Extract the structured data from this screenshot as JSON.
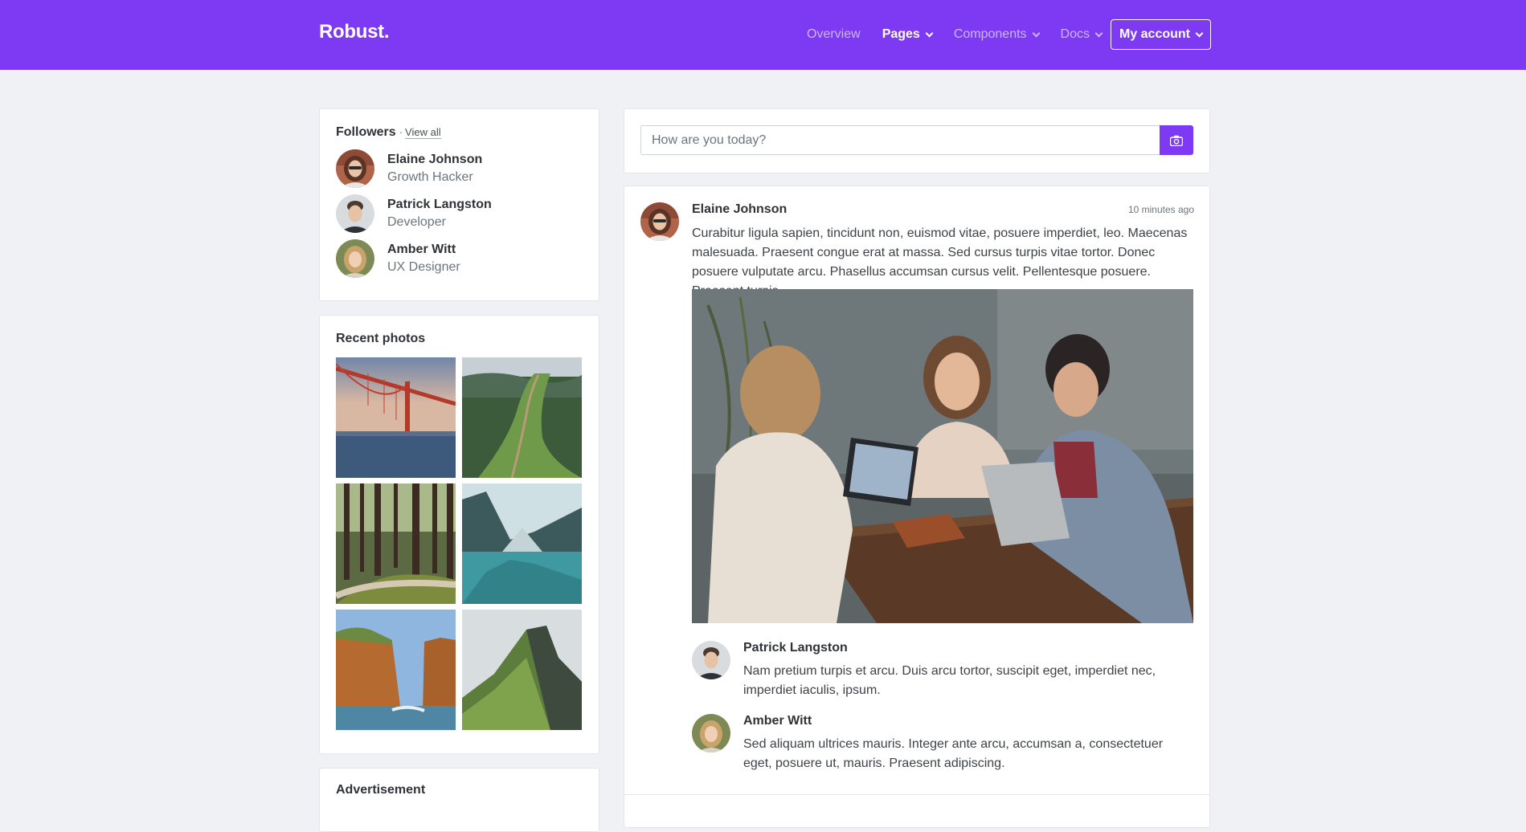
{
  "header": {
    "brand": "Robust.",
    "nav": [
      {
        "label": "Overview",
        "active": false,
        "dropdown": false
      },
      {
        "label": "Pages",
        "active": true,
        "dropdown": true
      },
      {
        "label": "Components",
        "active": false,
        "dropdown": true
      },
      {
        "label": "Docs",
        "active": false,
        "dropdown": true
      }
    ],
    "account_label": "My account",
    "accent_color": "#7e3af2"
  },
  "followers": {
    "title": "Followers",
    "separator": "·",
    "view_all": "View all",
    "items": [
      {
        "name": "Elaine Johnson",
        "role": "Growth Hacker"
      },
      {
        "name": "Patrick Langston",
        "role": "Developer"
      },
      {
        "name": "Amber Witt",
        "role": "UX Designer"
      }
    ]
  },
  "recent_photos": {
    "title": "Recent photos",
    "items": [
      "bridge",
      "mountain-trail",
      "forest-path",
      "mountain-lake",
      "sea-cliffs",
      "green-cliff"
    ]
  },
  "advertisement": {
    "title": "Advertisement"
  },
  "composer": {
    "placeholder": "How are you today?",
    "button_icon": "camera-icon"
  },
  "post": {
    "author": "Elaine Johnson",
    "time": "10 minutes ago",
    "text": "Curabitur ligula sapien, tincidunt non, euismod vitae, posuere imperdiet, leo. Maecenas malesuada. Praesent congue erat at massa. Sed cursus turpis vitae tortor. Donec posuere vulputate arcu. Phasellus accumsan cursus velit. Pellentesque posuere. Praesent turpis.",
    "image": "three-friends-with-laptops",
    "comments": [
      {
        "name": "Patrick Langston",
        "text": "Nam pretium turpis et arcu. Duis arcu tortor, suscipit eget, imperdiet nec, imperdiet iaculis, ipsum."
      },
      {
        "name": "Amber Witt",
        "text": "Sed aliquam ultrices mauris. Integer ante arcu, accumsan a, consectetuer eget, posuere ut, mauris. Praesent adipiscing."
      }
    ]
  }
}
